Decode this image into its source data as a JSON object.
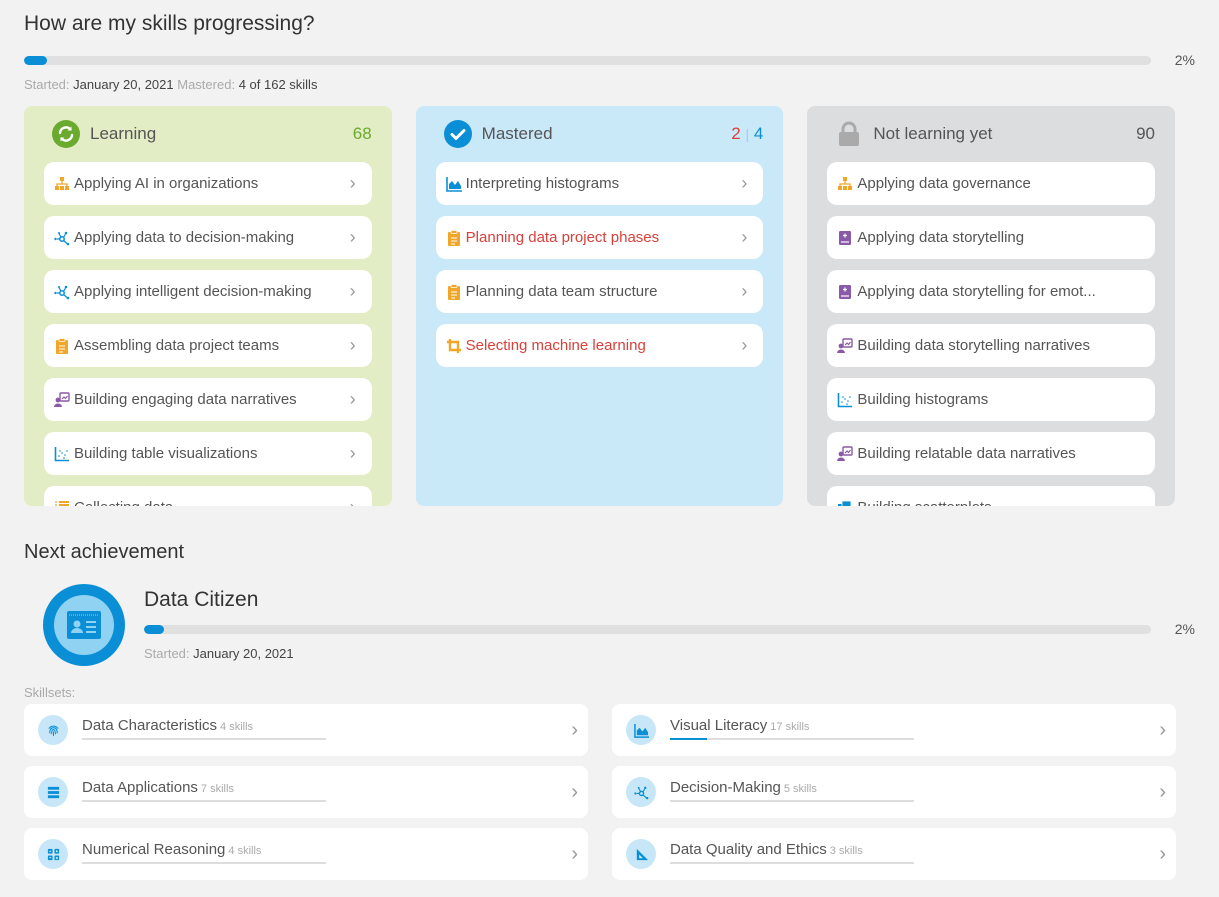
{
  "overview": {
    "title": "How are my skills progressing?",
    "progress_percent": 2,
    "progress_label": "2%",
    "started_label": "Started:",
    "started_value": "January 20, 2021",
    "mastered_label": "Mastered:",
    "mastered_value": "4 of 162 skills"
  },
  "columns": {
    "learning": {
      "title": "Learning",
      "count": "68",
      "color": "#6aaa2e",
      "items": [
        {
          "label": "Applying AI in organizations",
          "icon": "org-chart-icon",
          "icon_color": "#f0a629"
        },
        {
          "label": "Applying data to decision-making",
          "icon": "network-icon",
          "icon_color": "#0a8fd6"
        },
        {
          "label": "Applying intelligent decision-making",
          "icon": "network-icon",
          "icon_color": "#0a8fd6"
        },
        {
          "label": "Assembling data project teams",
          "icon": "clipboard-icon",
          "icon_color": "#f0a629"
        },
        {
          "label": "Building engaging data narratives",
          "icon": "presenter-icon",
          "icon_color": "#8a5aa8"
        },
        {
          "label": "Building table visualizations",
          "icon": "scatter-chart-icon",
          "icon_color": "#0a8fd6"
        },
        {
          "label": "Collecting data",
          "icon": "list-icon",
          "icon_color": "#f0a629"
        }
      ]
    },
    "mastered": {
      "title": "Mastered",
      "count_red": "2",
      "count_sep": "|",
      "count_blue": "4",
      "items": [
        {
          "label": "Interpreting histograms",
          "icon": "area-chart-icon",
          "icon_color": "#0a8fd6",
          "highlight": false
        },
        {
          "label": "Planning data project phases",
          "icon": "clipboard-icon",
          "icon_color": "#f0a629",
          "highlight": true
        },
        {
          "label": "Planning data team structure",
          "icon": "clipboard-icon",
          "icon_color": "#f0a629",
          "highlight": false
        },
        {
          "label": "Selecting machine learning",
          "icon": "crop-icon",
          "icon_color": "#f0a629",
          "highlight": true
        }
      ]
    },
    "notyet": {
      "title": "Not learning yet",
      "count": "90",
      "items": [
        {
          "label": "Applying data governance",
          "icon": "org-chart-icon",
          "icon_color": "#f0a629"
        },
        {
          "label": "Applying data storytelling",
          "icon": "book-icon",
          "icon_color": "#8a5aa8"
        },
        {
          "label": "Applying data storytelling for emot...",
          "icon": "book-icon",
          "icon_color": "#8a5aa8"
        },
        {
          "label": "Building data storytelling narratives",
          "icon": "presenter-icon",
          "icon_color": "#8a5aa8"
        },
        {
          "label": "Building histograms",
          "icon": "scatter-chart-icon",
          "icon_color": "#0a8fd6"
        },
        {
          "label": "Building relatable data narratives",
          "icon": "presenter-icon",
          "icon_color": "#8a5aa8"
        },
        {
          "label": "Building scatterplots",
          "icon": "documents-icon",
          "icon_color": "#0a8fd6"
        }
      ]
    }
  },
  "achievement": {
    "heading": "Next achievement",
    "title": "Data Citizen",
    "progress_percent": 2,
    "progress_label": "2%",
    "started_label": "Started:",
    "started_value": "January 20, 2021",
    "skillsets_label": "Skillsets:"
  },
  "skillsets": [
    {
      "name": "Data Characteristics",
      "count": "4 skills",
      "icon": "fingerprint-icon",
      "progress_percent": 0
    },
    {
      "name": "Visual Literacy",
      "count": "17 skills",
      "icon": "area-chart-icon",
      "progress_percent": 15
    },
    {
      "name": "Data Applications",
      "count": "7 skills",
      "icon": "server-icon",
      "progress_percent": 0
    },
    {
      "name": "Decision-Making",
      "count": "5 skills",
      "icon": "network-icon",
      "progress_percent": 0
    },
    {
      "name": "Numerical Reasoning",
      "count": "4 skills",
      "icon": "calculator-icon",
      "progress_percent": 0
    },
    {
      "name": "Data Quality and Ethics",
      "count": "3 skills",
      "icon": "triangle-ruler-icon",
      "progress_percent": 0
    }
  ],
  "colors": {
    "accent": "#0a8fd6",
    "learning_bg": "#e2edc5",
    "mastered_bg": "#c9e8f8",
    "notyet_bg": "#dcdddf",
    "highlight_red": "#d9403a"
  }
}
